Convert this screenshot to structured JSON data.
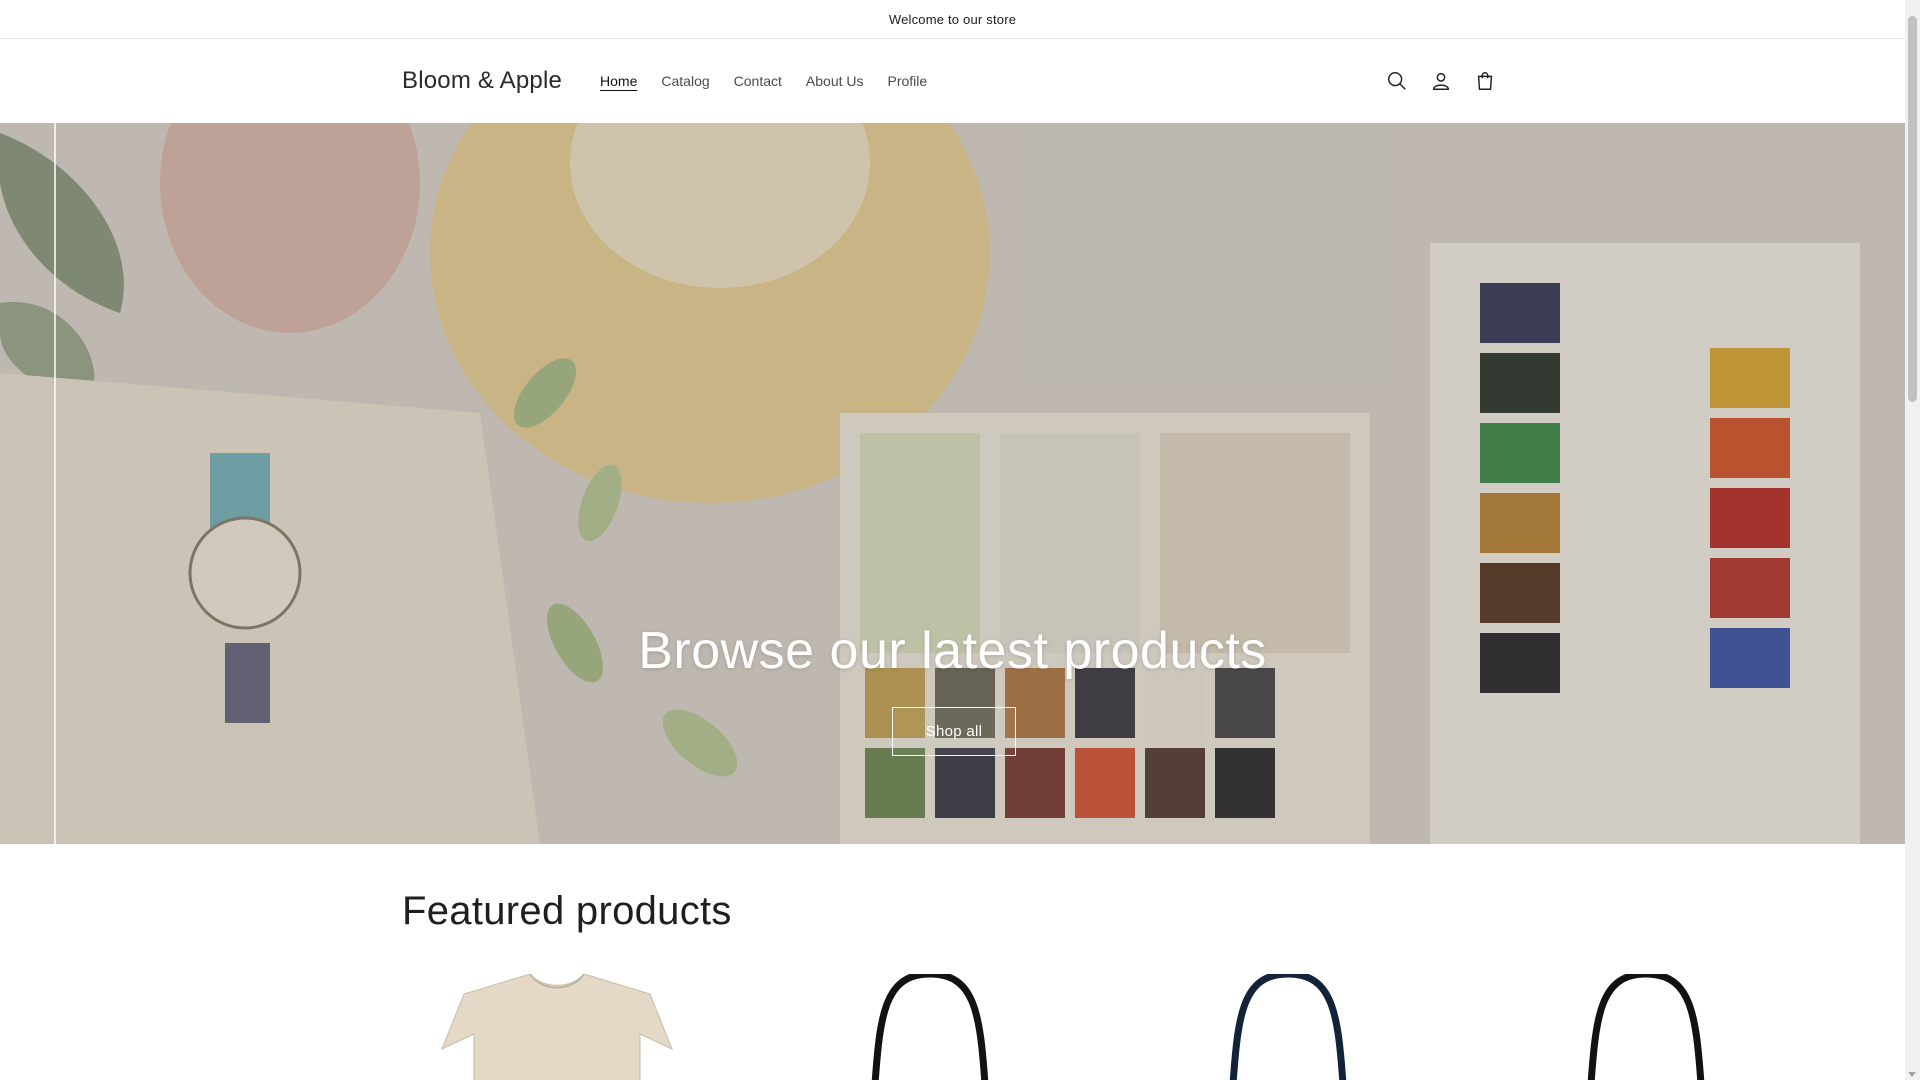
{
  "announcement": {
    "text": "Welcome to our store"
  },
  "header": {
    "logo": "Bloom & Apple",
    "nav": [
      {
        "label": "Home",
        "active": true
      },
      {
        "label": "Catalog",
        "active": false
      },
      {
        "label": "Contact",
        "active": false
      },
      {
        "label": "About Us",
        "active": false
      },
      {
        "label": "Profile",
        "active": false
      }
    ],
    "icons": [
      "search-icon",
      "account-icon",
      "cart-icon"
    ]
  },
  "hero": {
    "title": "Browse our latest products",
    "button_label": "Shop all"
  },
  "featured": {
    "title": "Featured products",
    "products": [
      {
        "kind": "t-shirt",
        "color": "#e3d9c6"
      },
      {
        "kind": "tote-bag",
        "color": "#121212"
      },
      {
        "kind": "tote-bag",
        "color": "#13233a"
      },
      {
        "kind": "tote-bag",
        "color": "#121212"
      }
    ]
  },
  "colors": {
    "text": "#121212",
    "overlay": "rgba(70,60,50,0.18)",
    "hero_text": "#ffffff"
  }
}
